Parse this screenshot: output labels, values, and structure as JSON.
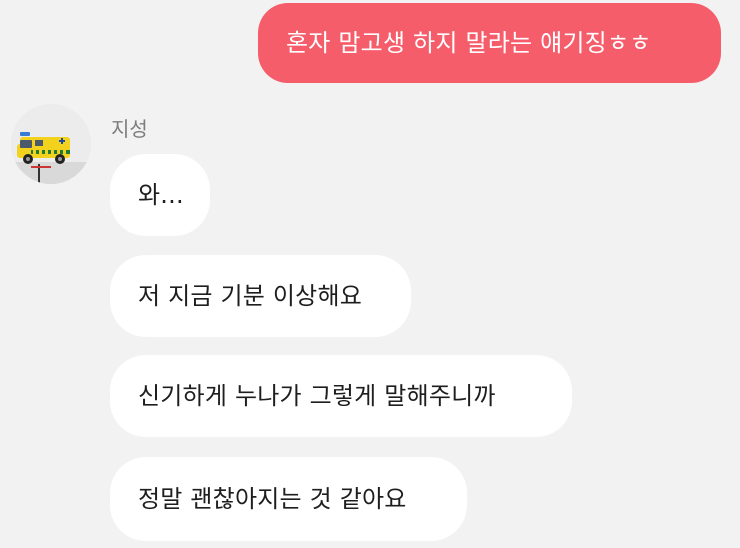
{
  "messages": {
    "outgoing": [
      {
        "text": "혼자 맘고생 하지 말라는 얘기징ㅎㅎ"
      }
    ],
    "incoming_group": {
      "sender_name": "지성",
      "avatar_icon": "ambulance-avatar-icon",
      "bubbles": [
        {
          "text": "와..."
        },
        {
          "text": "저 지금 기분 이상해요"
        },
        {
          "text": "신기하게 누나가 그렇게 말해주니까"
        },
        {
          "text": "정말 괜찮아지는 것 같아요"
        }
      ]
    }
  },
  "colors": {
    "background": "#f2f2f2",
    "outgoing_bubble": "#f65d6b",
    "incoming_bubble": "#ffffff",
    "sender_name": "#7d7d7d"
  }
}
